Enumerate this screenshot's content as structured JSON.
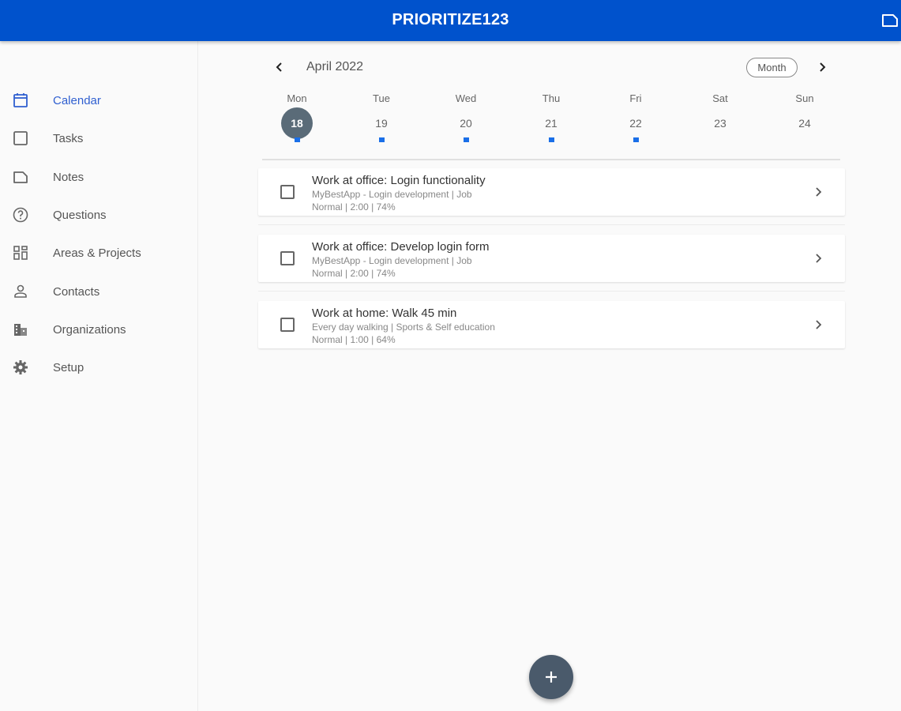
{
  "app": {
    "title": "PRIORITIZE123",
    "header_action_icon": "note-icon",
    "primary_color": "#0052cc"
  },
  "sidebar": {
    "items": [
      {
        "label": "Calendar",
        "icon": "calendar-icon",
        "active": true
      },
      {
        "label": "Tasks",
        "icon": "checkbox-icon",
        "active": false
      },
      {
        "label": "Notes",
        "icon": "note-icon",
        "active": false
      },
      {
        "label": "Questions",
        "icon": "question-icon",
        "active": false
      },
      {
        "label": "Areas & Projects",
        "icon": "grid-icon",
        "active": false
      },
      {
        "label": "Contacts",
        "icon": "person-icon",
        "active": false
      },
      {
        "label": "Organizations",
        "icon": "building-icon",
        "active": false
      },
      {
        "label": "Setup",
        "icon": "gear-icon",
        "active": false
      }
    ]
  },
  "calendar": {
    "month_label": "April 2022",
    "view_button": "Month",
    "days": [
      {
        "name": "Mon",
        "num": "18",
        "selected": true,
        "has_tasks": true
      },
      {
        "name": "Tue",
        "num": "19",
        "selected": false,
        "has_tasks": true
      },
      {
        "name": "Wed",
        "num": "20",
        "selected": false,
        "has_tasks": true
      },
      {
        "name": "Thu",
        "num": "21",
        "selected": false,
        "has_tasks": true
      },
      {
        "name": "Fri",
        "num": "22",
        "selected": false,
        "has_tasks": true
      },
      {
        "name": "Sat",
        "num": "23",
        "selected": false,
        "has_tasks": false
      },
      {
        "name": "Sun",
        "num": "24",
        "selected": false,
        "has_tasks": false
      }
    ],
    "selected_color": "#5a6b78",
    "dot_color": "#1a6fe8"
  },
  "tasks": [
    {
      "title": "Work at office: Login functionality",
      "subtitle": "MyBestApp - Login development | Job",
      "meta": "Normal | 2:00 | 74%"
    },
    {
      "title": "Work at office: Develop login form",
      "subtitle": "MyBestApp - Login development | Job",
      "meta": "Normal | 2:00 | 74%"
    },
    {
      "title": "Work at home: Walk 45 min",
      "subtitle": "Every day walking | Sports & Self education",
      "meta": "Normal | 1:00 | 64%"
    }
  ],
  "fab": {
    "icon": "plus-icon",
    "color": "#4a5a6b"
  }
}
